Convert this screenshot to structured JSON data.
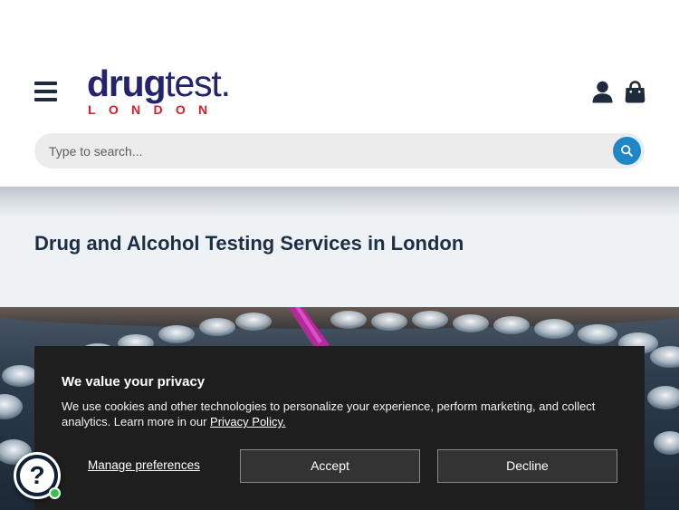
{
  "header": {
    "logo": {
      "main_bold": "drug",
      "main_light": "test.",
      "sub": "LONDON"
    },
    "search": {
      "placeholder": "Type to search..."
    }
  },
  "hero": {
    "title": "Drug and Alcohol Testing Services in London"
  },
  "cookie_banner": {
    "title": "We value your privacy",
    "text": "We use cookies and other technologies to personalize your experience, perform marketing, and collect analytics. Learn more in our",
    "privacy_link": "Privacy Policy.",
    "manage_label": "Manage preferences",
    "accept_label": "Accept",
    "decline_label": "Decline"
  },
  "help_widget": {
    "icon_text": "?",
    "status": "online"
  },
  "colors": {
    "logo_navy": "#23236e",
    "logo_red": "#d21f2b",
    "title_navy": "#1d2f45",
    "search_button": "#1f86c8",
    "banner_bg": "#1e1e1e",
    "status_green": "#36c24a"
  },
  "icons": [
    "menu-icon",
    "account-icon",
    "cart-bag-icon",
    "search-icon",
    "help-icon"
  ]
}
